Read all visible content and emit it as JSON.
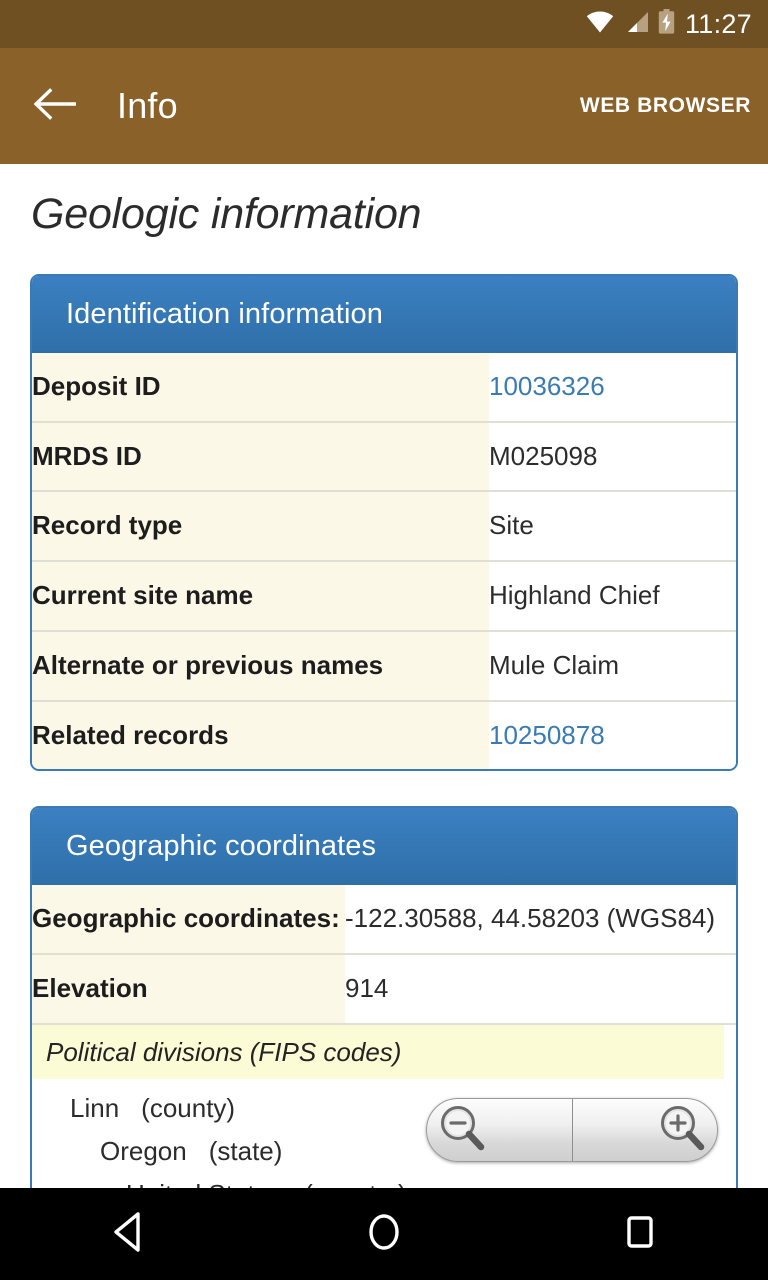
{
  "status_bar": {
    "time": "11:27",
    "icons": [
      "wifi-icon",
      "cellular-signal-icon",
      "battery-charging-icon"
    ],
    "background_color": "#6f5022"
  },
  "app_bar": {
    "back_icon": "back-arrow-icon",
    "title": "Info",
    "action_label": "WEB BROWSER",
    "background_color": "#8a6129"
  },
  "page": {
    "title": "Geologic information"
  },
  "cards": [
    {
      "header": "Identification information",
      "rows": [
        {
          "label": "Deposit ID",
          "value": "10036326",
          "is_link": true
        },
        {
          "label": "MRDS ID",
          "value": "M025098",
          "is_link": false
        },
        {
          "label": "Record type",
          "value": "Site",
          "is_link": false
        },
        {
          "label": "Current site name",
          "value": "Highland Chief",
          "is_link": false
        },
        {
          "label": "Alternate or previous names",
          "value": "Mule Claim",
          "is_link": false
        },
        {
          "label": "Related records",
          "value": "10250878",
          "is_link": true
        }
      ]
    },
    {
      "header": "Geographic coordinates",
      "rows": [
        {
          "label": "Geographic coordinates:",
          "value": "-122.30588, 44.58203 (WGS84)",
          "is_link": false
        },
        {
          "label": "Elevation",
          "value": "914",
          "is_link": false
        }
      ],
      "political_divisions": {
        "title": "Political divisions (FIPS codes)",
        "entries": [
          {
            "name": "Linn",
            "type": "(county)"
          },
          {
            "name": "Oregon",
            "type": "(state)"
          },
          {
            "name": "United States",
            "type": "(country)"
          }
        ]
      }
    }
  ],
  "zoom_controls": {
    "zoom_out_icon": "zoom-out-icon",
    "zoom_in_icon": "zoom-in-icon"
  },
  "nav_bar": {
    "buttons": [
      "back-triangle-icon",
      "home-circle-icon",
      "recents-square-icon"
    ]
  },
  "colors": {
    "accent_blue": "#3a7bb5",
    "link_blue": "#3a7bb5",
    "label_cream": "#fcf8e7",
    "politic_yellow": "#fbfbd6",
    "toolbar_brown": "#8a6129",
    "statusbar_brown": "#6f5022"
  }
}
